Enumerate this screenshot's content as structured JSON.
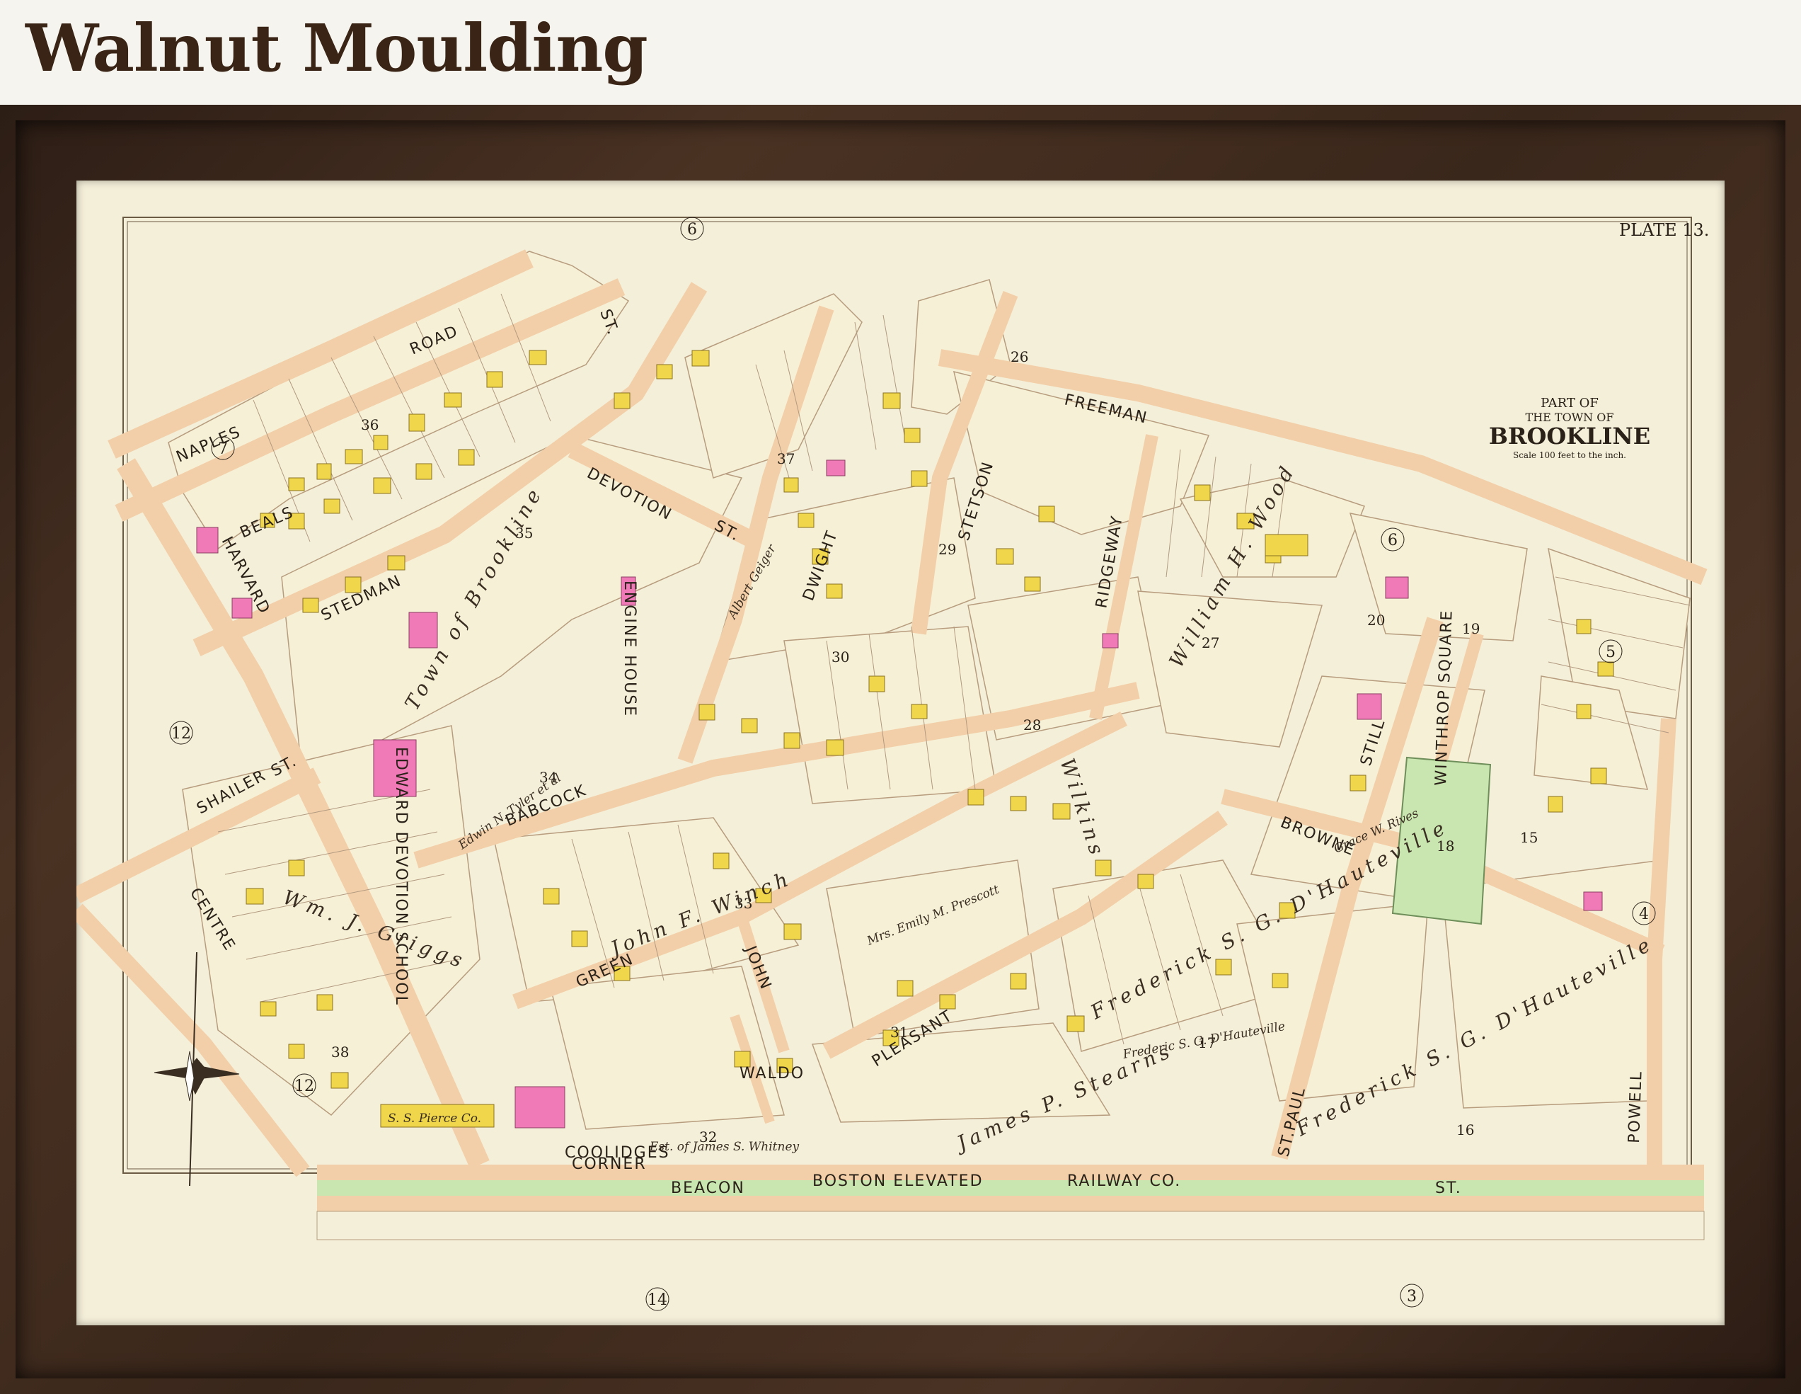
{
  "header": {
    "title": "Walnut Moulding"
  },
  "map": {
    "plate": "PLATE 13.",
    "cartouche": {
      "line1": "PART OF",
      "line2": "THE TOWN OF",
      "line3": "BROOKLINE",
      "scale": "Scale 100 feet to the inch."
    },
    "plate_refs": [
      "6",
      "7",
      "12",
      "12",
      "6",
      "5",
      "4",
      "3",
      "14"
    ],
    "blocks": [
      "36",
      "35",
      "34",
      "37",
      "26",
      "29",
      "28",
      "27",
      "30",
      "33",
      "31",
      "32",
      "38",
      "20",
      "19",
      "18",
      "15",
      "17",
      "16"
    ],
    "streets": {
      "naples": "NAPLES",
      "road": "ROAD",
      "beals": "BEALS",
      "st_top": "ST.",
      "harvard": "HARVARD",
      "stedman": "STEDMAN",
      "devotion": "DEVOTION",
      "devotion_st": "ST.",
      "dwight": "DWIGHT",
      "stetson": "STETSON",
      "freeman": "FREEMAN",
      "ridgeway": "RIDGEWAY",
      "shailer": "SHAILER",
      "shailer_st": "ST.",
      "centre": "CENTRE",
      "babcock": "BABCOCK",
      "green": "GREEN",
      "john": "JOHN",
      "waldo": "WALDO",
      "pleasant": "PLEASANT",
      "browne": "BROWNE",
      "still": "STILL",
      "st_paul": "ST.PAUL",
      "powell": "POWELL",
      "beacon": "BEACON",
      "beacon_st": "ST.",
      "railway": "BOSTON ELEVATED",
      "railway2": "RAILWAY CO.",
      "coolidges": "COOLIDGES",
      "corner": "CORNER"
    },
    "places": {
      "winthrop_square": "WINTHROP SQUARE",
      "town_of_brookline": "Town of Brookline",
      "edward_devotion_school": "EDWARD DEVOTION SCHOOL",
      "engine_house": "ENGINE HOUSE"
    },
    "owners": {
      "griggs": "Wm. J. Griggs",
      "tyler": "Edwin N. Tyler et al",
      "geiger": "Albert Geiger",
      "stearns": "James P. Stearns",
      "hauteville": "Frederick S. G. D'Hauteville",
      "hauteville2": "Frederick S. G. D'Hauteville",
      "rives": "Grace W. Rives",
      "william": "William H. Wood",
      "wilkins": "Wilkins",
      "prescott": "Mrs. Emily M. Prescott",
      "winch": "John F. Winch",
      "whitney": "Est. of James S. Whitney",
      "hauteville3": "Frederic S. G. D'Hauteville",
      "pierce": "S. S. Pierce Co."
    },
    "colors": {
      "paper": "#f4efd9",
      "street": "#f2cfa8",
      "wood": "#f0d64a",
      "brick": "#f07ab8",
      "park": "#c9e6b0",
      "frame": "#3a271b"
    }
  }
}
